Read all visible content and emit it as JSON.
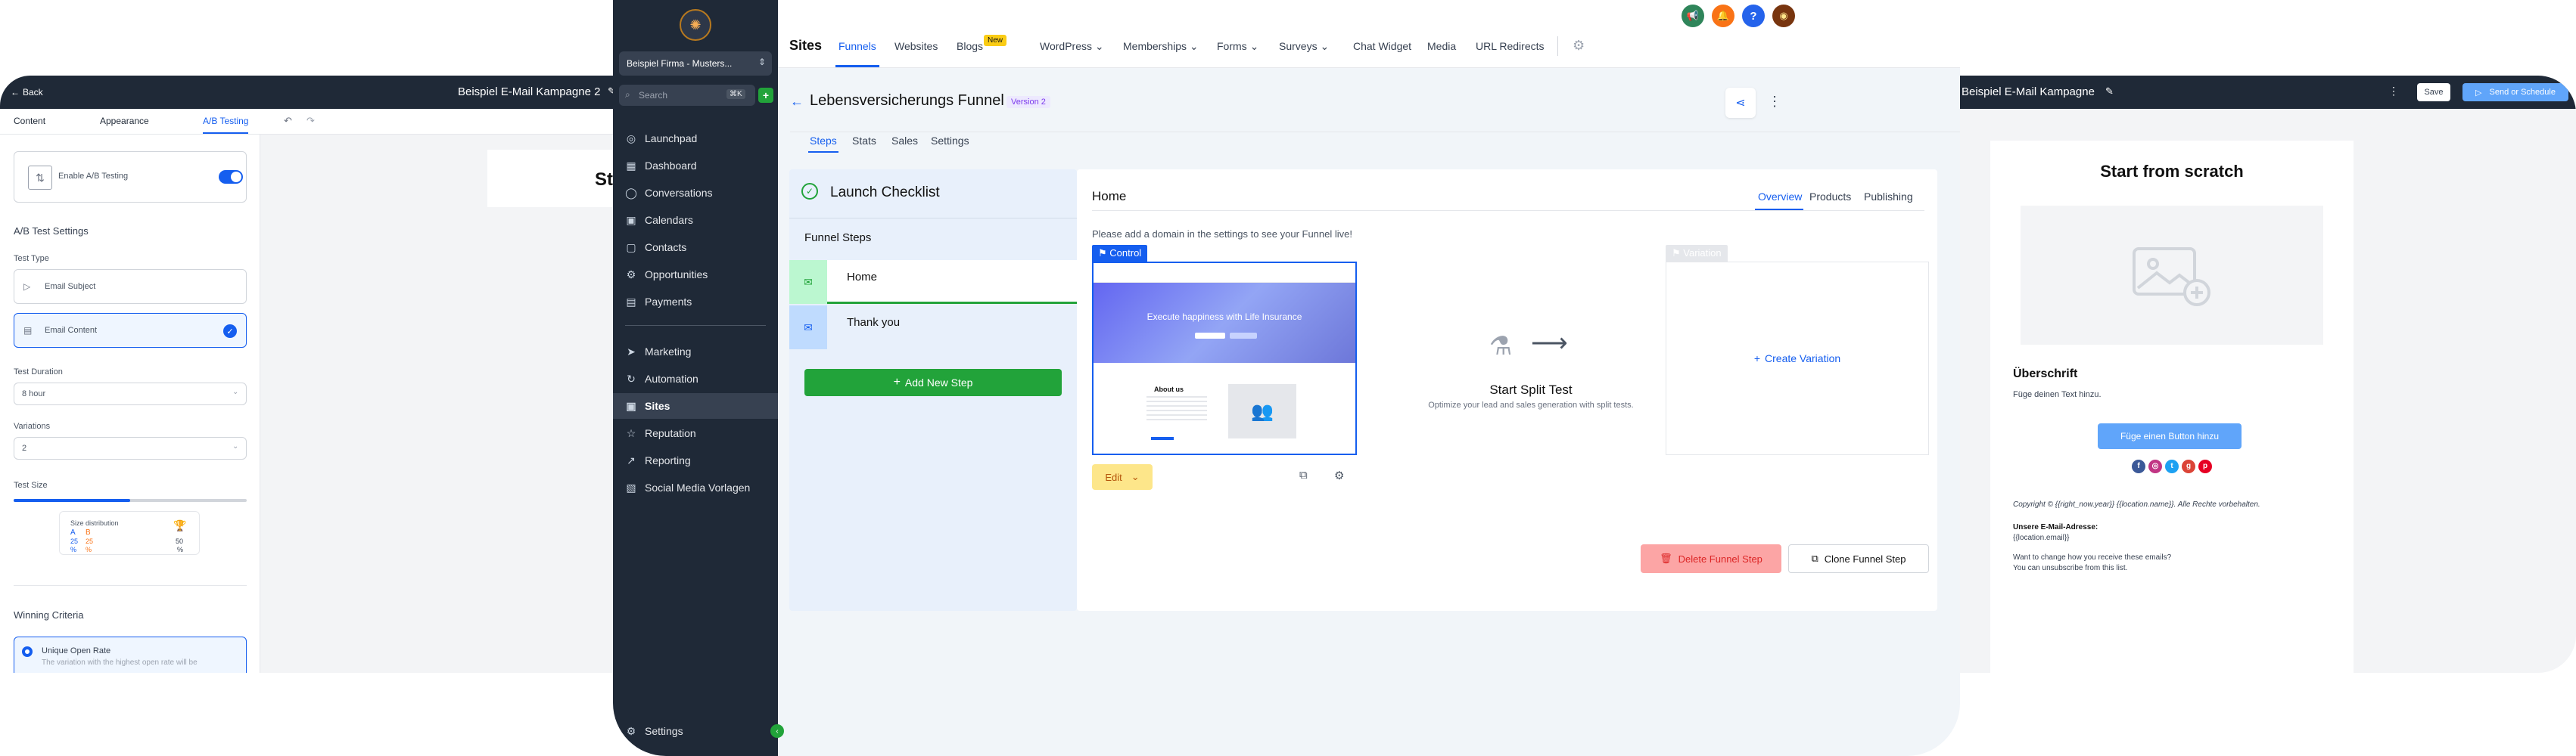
{
  "left_editor": {
    "back_label": "Back",
    "title": "Beispiel E-Mail Kampagne 2",
    "tabs": [
      "Content",
      "Appearance",
      "A/B Testing"
    ],
    "enable_ab_label": "Enable A/B Testing",
    "ab_settings_heading": "A/B Test Settings",
    "test_type_label": "Test Type",
    "test_type_options": [
      "Email Subject",
      "Email Content"
    ],
    "test_duration_label": "Test Duration",
    "test_duration_value": "8 hour",
    "variations_label": "Variations",
    "variations_value": "2",
    "test_size_label": "Test Size",
    "test_size_fraction": 0.5,
    "size_distribution_label": "Size distribution",
    "dist_a": "A",
    "dist_b": "B",
    "dist_a_value": "25",
    "dist_b_value": "25",
    "dist_pct": "%",
    "winner_value": "50",
    "winning_criteria_heading": "Winning Criteria",
    "criteria_option": "Unique Open Rate",
    "criteria_desc": "The variation with the highest open rate will be",
    "canvas_heading": "St"
  },
  "sidebar": {
    "account_name": "Beispiel Firma - Musters...",
    "search_placeholder": "Search",
    "search_shortcut": "⌘K",
    "items_top": [
      "Launchpad",
      "Dashboard",
      "Conversations",
      "Calendars",
      "Contacts",
      "Opportunities",
      "Payments"
    ],
    "items_bottom": [
      "Marketing",
      "Automation",
      "Sites",
      "Reputation",
      "Reporting",
      "Social Media Vorlagen"
    ],
    "active_item": "Sites",
    "settings_label": "Settings"
  },
  "topnav": {
    "title": "Sites",
    "tabs": [
      "Funnels",
      "Websites",
      "Blogs",
      "WordPress",
      "Memberships",
      "Forms",
      "Surveys",
      "Chat Widget",
      "Media",
      "URL Redirects"
    ],
    "active_tab": "Funnels",
    "blogs_badge": "New",
    "dropdown_tabs": [
      "WordPress",
      "Memberships",
      "Forms",
      "Surveys"
    ]
  },
  "funnel": {
    "title": "Lebensversicherungs Funnel",
    "version_badge": "Version 2",
    "subtabs": [
      "Steps",
      "Stats",
      "Sales",
      "Settings"
    ],
    "active_subtab": "Steps",
    "checklist_label": "Launch Checklist",
    "funnel_steps_label": "Funnel Steps",
    "steps": [
      "Home",
      "Thank you"
    ],
    "add_step_label": "Add New Step",
    "step_title": "Home",
    "step_tabs": [
      "Overview",
      "Products",
      "Publishing"
    ],
    "active_step_tab": "Overview",
    "domain_notice": "Please add a domain in the settings to see your Funnel live!",
    "control_label": "Control",
    "variation_label": "Variation",
    "preview_headline": "Execute happiness with Life Insurance",
    "preview_about": "About us",
    "edit_label": "Edit",
    "split_test_title": "Start Split Test",
    "split_test_desc": "Optimize your lead and sales generation with split tests.",
    "create_variation_label": "Create Variation",
    "delete_step_label": "Delete Funnel Step",
    "clone_step_label": "Clone Funnel Step"
  },
  "right_editor": {
    "title": "Beispiel E-Mail Kampagne",
    "save_label": "Save",
    "send_label": "Send or Schedule",
    "heading": "Start from scratch",
    "subheading": "Überschrift",
    "body_text": "Füge deinen Text hinzu.",
    "button_label": "Füge einen Button hinzu",
    "copyright": "Copyright © {{right_now.year}} {{location.name}}. Alle Rechte vorbehalten.",
    "address_label": "Unsere E-Mail-Adresse:",
    "address_value": "{{location.email}}",
    "change_text": "Want to change how you receive these emails?",
    "unsubscribe_text": "You can unsubscribe from this list."
  },
  "colors": {
    "accent": "#155eef",
    "sidebar_bg": "#1f2937",
    "green": "#22a33a",
    "danger": "#f87171",
    "top_icons": [
      "#2f855a",
      "#f97316",
      "#2563eb",
      "#78350f"
    ]
  }
}
